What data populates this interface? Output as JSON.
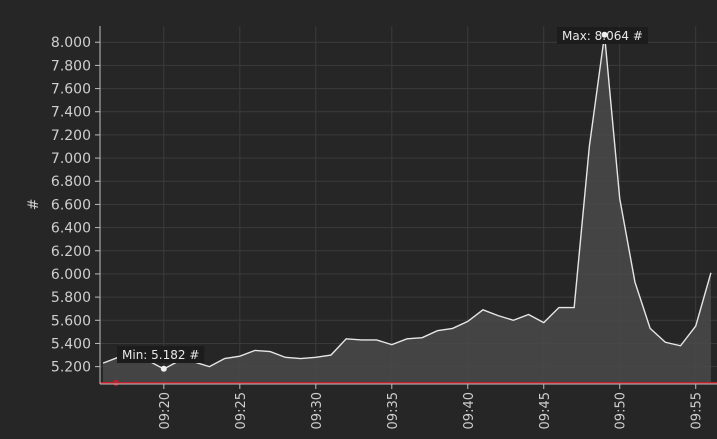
{
  "chart_data": {
    "type": "area",
    "ylabel": "#",
    "ylim": [
      5.05,
      8.14
    ],
    "y_ticks": [
      "5.200",
      "5.400",
      "5.600",
      "5.800",
      "6.000",
      "6.200",
      "6.400",
      "6.600",
      "6.800",
      "7.000",
      "7.200",
      "7.400",
      "7.600",
      "7.800",
      "8.000"
    ],
    "y_tick_values": [
      5.2,
      5.4,
      5.6,
      5.8,
      6.0,
      6.2,
      6.4,
      6.6,
      6.8,
      7.0,
      7.2,
      7.4,
      7.6,
      7.8,
      8.0
    ],
    "x_ticks": [
      "09:20",
      "09:25",
      "09:30",
      "09:35",
      "09:40",
      "09:45",
      "09:50",
      "09:55"
    ],
    "x_tick_minutes": [
      20,
      25,
      30,
      35,
      40,
      45,
      50,
      55
    ],
    "x_minutes": [
      16,
      17,
      18,
      19,
      20,
      21,
      22,
      23,
      24,
      25,
      26,
      27,
      28,
      29,
      30,
      31,
      32,
      33,
      34,
      35,
      36,
      37,
      38,
      39,
      40,
      41,
      42,
      43,
      44,
      45,
      46,
      47,
      48,
      49,
      50,
      51,
      52,
      53,
      54,
      55,
      56
    ],
    "y": [
      5.23,
      5.28,
      5.31,
      5.25,
      5.18,
      5.25,
      5.24,
      5.2,
      5.27,
      5.29,
      5.34,
      5.33,
      5.28,
      5.27,
      5.28,
      5.3,
      5.44,
      5.43,
      5.43,
      5.39,
      5.44,
      5.45,
      5.51,
      5.53,
      5.59,
      5.69,
      5.64,
      5.6,
      5.65,
      5.58,
      5.71,
      5.71,
      7.1,
      8.064,
      6.65,
      5.93,
      5.53,
      5.41,
      5.38,
      5.55,
      6.01
    ],
    "x_max": 56.4,
    "x_min": 15.8,
    "max_label": "Max: 8.064 #",
    "max_point": {
      "x": 49,
      "y": 8.064
    },
    "min_label": "Min: 5.182 #",
    "min_point": {
      "x": 20,
      "y": 5.182
    },
    "threshold": {
      "y": 5.06,
      "color": "#c0202a"
    },
    "colors": {
      "line": "#e6e6e6",
      "fill": "#4a4a4a",
      "grid": "#3b3b3b",
      "axis": "#bdbdbd",
      "plot_bg": "#262626",
      "label_bg": "#1c1c1c"
    }
  }
}
